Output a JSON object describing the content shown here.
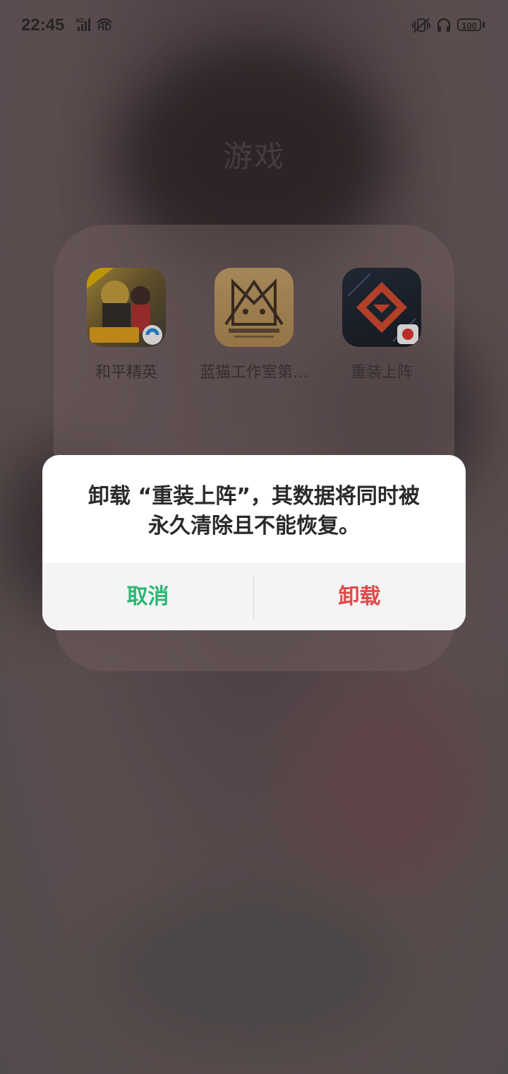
{
  "status_bar": {
    "time": "22:45",
    "network": "4G",
    "hd": "HD",
    "battery": "100"
  },
  "folder": {
    "title": "游戏",
    "apps": [
      {
        "label": "和平精英",
        "icon": "game-pubg-icon"
      },
      {
        "label": "蓝猫工作室第…",
        "icon": "bluecat-studio-icon"
      },
      {
        "label": "重装上阵",
        "icon": "zhongzhuang-icon"
      }
    ]
  },
  "dialog": {
    "message_line1": "卸载 “重装上阵”，其数据将同时被",
    "message_line2": "永久清除且不能恢复。",
    "cancel_label": "取消",
    "confirm_label": "卸载"
  },
  "colors": {
    "cancel": "#2bb673",
    "confirm": "#e04a4a"
  }
}
